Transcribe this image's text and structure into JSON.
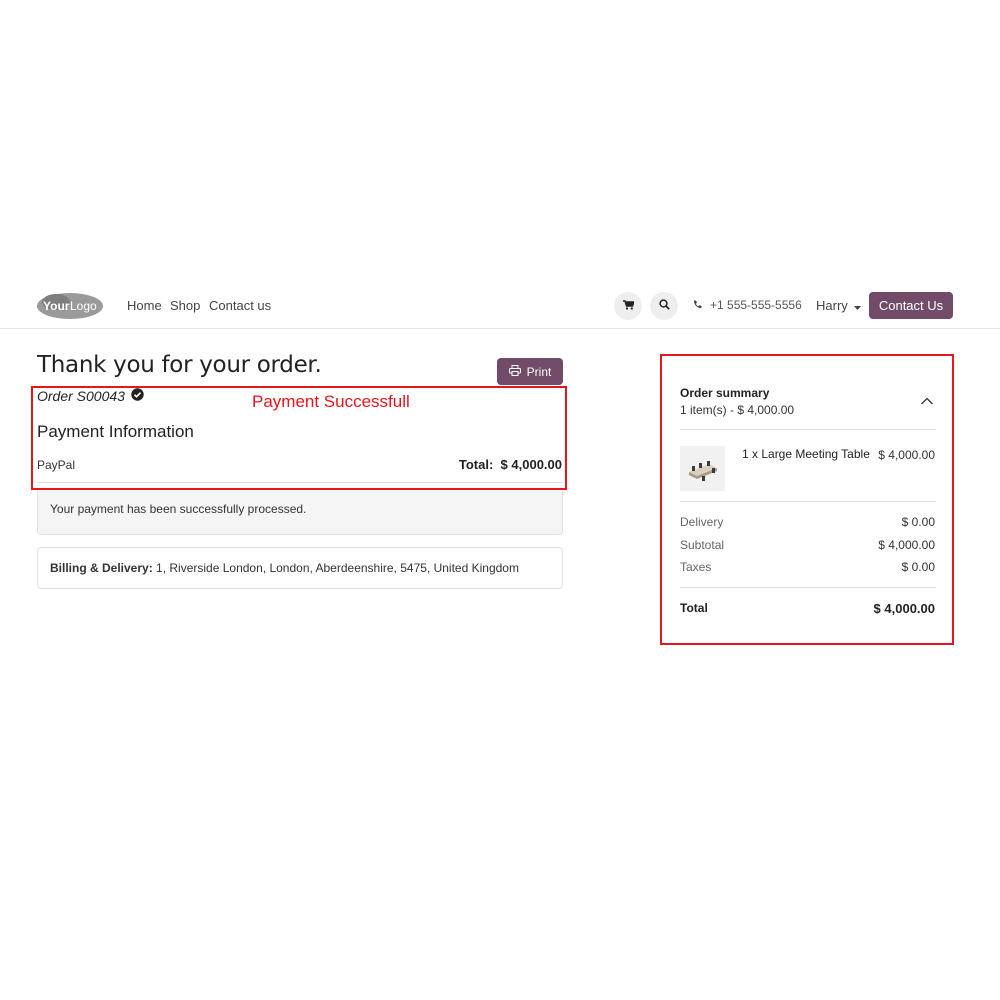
{
  "header": {
    "logo_text": "YourLogo",
    "nav": [
      "Home",
      "Shop",
      "Contact us"
    ],
    "phone": "+1 555-555-5556",
    "user": "Harry",
    "contact_button": "Contact Us",
    "icons": [
      "cart-icon",
      "search-icon",
      "phone-icon",
      "caret-down-icon"
    ]
  },
  "main": {
    "title": "Thank you for your order.",
    "print_label": "Print",
    "order_ref": "Order S00043",
    "annotation": "Payment Successfull",
    "payment_heading": "Payment Information",
    "payment_method": "PayPal",
    "total_label": "Total:",
    "total_value": "$ 4,000.00",
    "success_message": "Your payment has been successfully processed.",
    "billing_label": "Billing & Delivery:",
    "billing_address": "1, Riverside London, London, Aberdeenshire, 5475, United Kingdom"
  },
  "summary": {
    "title": "Order summary",
    "count": "1 item(s) -  $ 4,000.00",
    "product_name": "1 x Large Meeting Table",
    "product_price": "$ 4,000.00",
    "delivery_label": "Delivery",
    "delivery_value": "$ 0.00",
    "subtotal_label": "Subtotal",
    "subtotal_value": "$ 4,000.00",
    "taxes_label": "Taxes",
    "taxes_value": "$ 0.00",
    "total_label": "Total",
    "total_value": "$ 4,000.00"
  },
  "colors": {
    "brand": "#714b67",
    "annotation": "#e8141e"
  }
}
